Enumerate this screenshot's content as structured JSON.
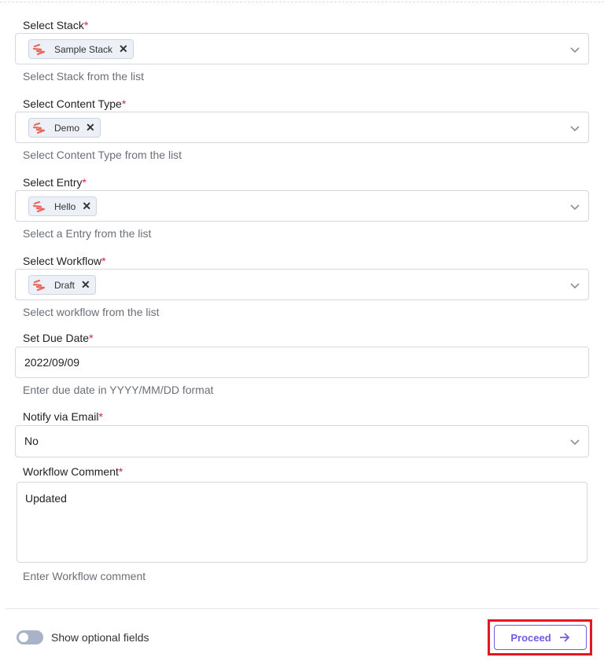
{
  "fields": [
    {
      "label": "Select Stack",
      "chip": "Sample Stack",
      "help": "Select Stack from the list"
    },
    {
      "label": "Select Content Type",
      "chip": "Demo",
      "help": "Select Content Type from the list"
    },
    {
      "label": "Select Entry",
      "chip": "Hello",
      "help": "Select a Entry from the list"
    },
    {
      "label": "Select Workflow",
      "chip": "Draft",
      "help": "Select workflow from the list"
    }
  ],
  "due_date": {
    "label": "Set Due Date",
    "value": "2022/09/09",
    "help": "Enter due date in YYYY/MM/DD format"
  },
  "notify": {
    "label": "Notify via Email",
    "value": "No"
  },
  "comment": {
    "label": "Workflow Comment",
    "value": "Updated",
    "help": "Enter Workflow comment"
  },
  "required_mark": "*",
  "footer": {
    "toggle_label": "Show optional fields",
    "toggle_on": false,
    "proceed_label": "Proceed"
  },
  "colors": {
    "accent": "#6c5ce7",
    "required": "#d6204c",
    "highlight": "#e8141e"
  }
}
